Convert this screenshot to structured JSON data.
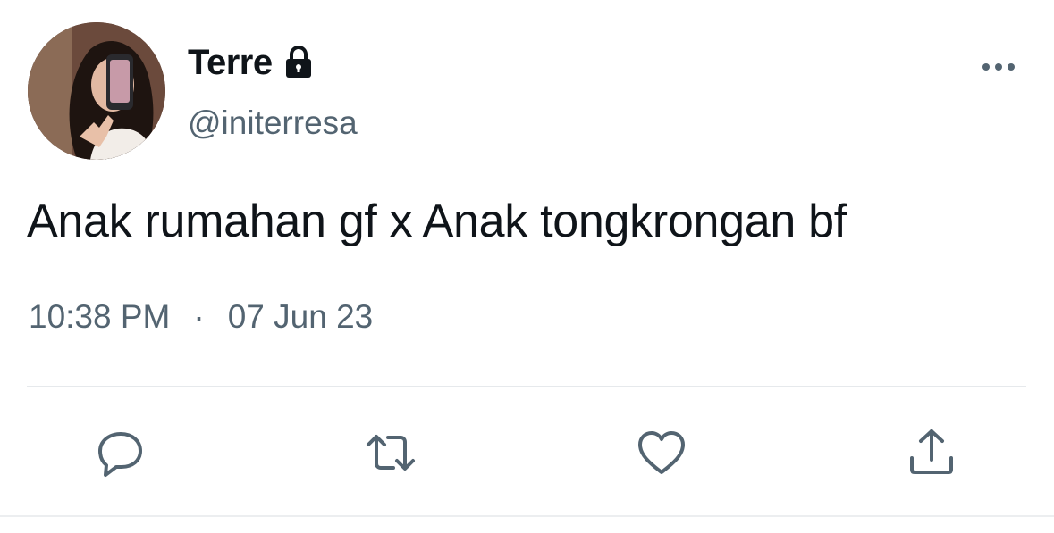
{
  "user": {
    "display_name": "Terre",
    "handle": "@initerresa",
    "protected_icon": "lock-icon",
    "avatar": "profile-photo"
  },
  "tweet": {
    "text": "Anak rumahan gf x Anak tongkrongan bf",
    "time": "10:38 PM",
    "separator": "·",
    "date": "07 Jun 23"
  },
  "actions": [
    {
      "name": "reply",
      "icon": "speech-bubble-icon"
    },
    {
      "name": "retweet",
      "icon": "retweet-arrows-icon"
    },
    {
      "name": "like",
      "icon": "heart-icon"
    },
    {
      "name": "share",
      "icon": "share-upload-icon"
    }
  ],
  "menu": {
    "icon": "more-dots-icon"
  },
  "colors": {
    "text_primary": "#0f1419",
    "text_secondary": "#536471",
    "divider": "#e6e9ec"
  }
}
